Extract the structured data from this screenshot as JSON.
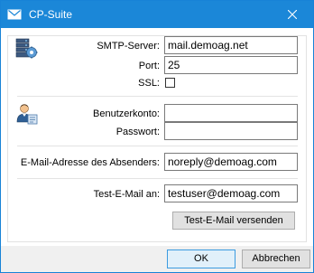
{
  "window": {
    "title": "CP-Suite",
    "app_icon": "envelope-icon",
    "close_icon": "close-icon",
    "accent_color": "#1b87d8"
  },
  "smtp": {
    "section_icon": "server-settings-icon",
    "server_label": "SMTP-Server:",
    "server_value": "mail.demoag.net",
    "port_label": "Port:",
    "port_value": "25",
    "ssl_label": "SSL:",
    "ssl_checked": false
  },
  "account": {
    "section_icon": "user-account-icon",
    "username_label": "Benutzerkonto:",
    "username_value": "",
    "password_label": "Passwort:",
    "password_value": ""
  },
  "sender": {
    "label": "E-Mail-Adresse des Absenders:",
    "value": "noreply@demoag.com"
  },
  "test": {
    "label": "Test-E-Mail an:",
    "value": "testuser@demoag.com",
    "send_button": "Test-E-Mail versenden"
  },
  "footer": {
    "ok_button": "OK",
    "cancel_button": "Abbrechen"
  }
}
